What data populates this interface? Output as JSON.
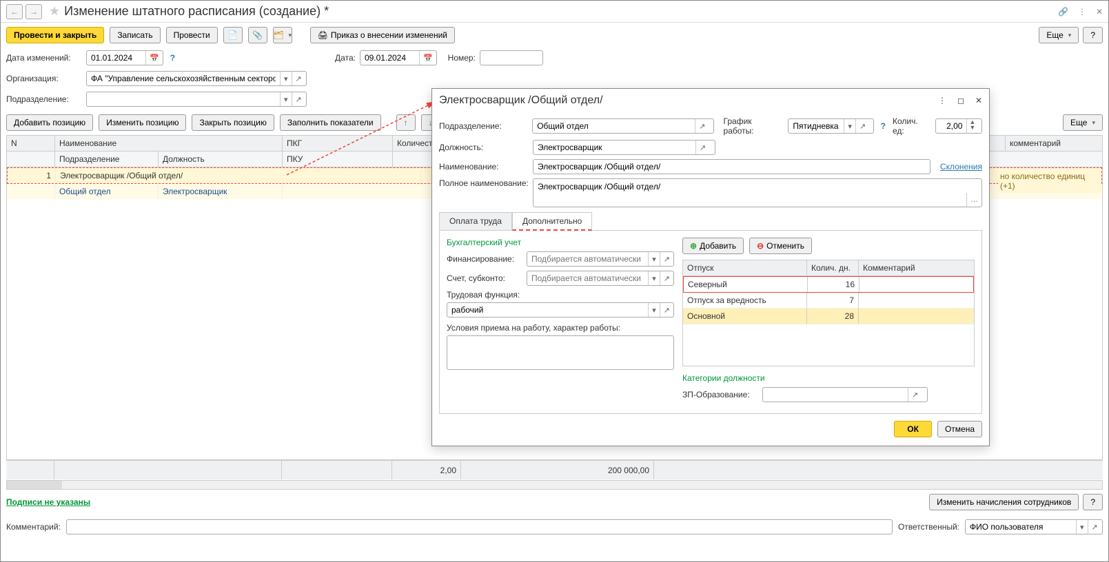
{
  "header": {
    "title": "Изменение штатного расписания (создание) *"
  },
  "toolbar": {
    "postAndClose": "Провести и закрыть",
    "save": "Записать",
    "post": "Провести",
    "orderBtn": "Приказ о внесении изменений",
    "more": "Еще",
    "help": "?",
    "moreRight": "Еще"
  },
  "form": {
    "dateChangesLabel": "Дата изменений:",
    "dateChanges": "01.01.2024",
    "dateLabel": "Дата:",
    "date": "09.01.2024",
    "numberLabel": "Номер:",
    "number": "",
    "orgLabel": "Организация:",
    "org": "ФА \"Управление сельскохозяйственным сектором\"",
    "subdivLabel": "Подразделение:",
    "subdiv": ""
  },
  "actions": {
    "addPos": "Добавить позицию",
    "editPos": "Изменить позицию",
    "closePos": "Закрыть позицию",
    "fillIndicators": "Заполнить показатели"
  },
  "grid": {
    "headers": {
      "n": "N",
      "name": "Наименование",
      "pkg": "ПКГ",
      "qty": "Количест"
    },
    "subheaders": {
      "subdiv": "Подразделение",
      "position": "Должность",
      "pku": "ПКУ"
    },
    "row": {
      "n": "1",
      "name": "Электросварщик /Общий отдел/",
      "subdiv": "Общий отдел",
      "position": "Электросварщик"
    },
    "rightNote1": "комментарий",
    "rightNote2": "но количество единиц (+1)"
  },
  "totals": {
    "qty": "2,00",
    "amount": "200 000,00"
  },
  "footer": {
    "signs": "Подписи не указаны",
    "changeAccruals": "Изменить начисления сотрудников",
    "commentLabel": "Комментарий:",
    "respLabel": "Ответственный:",
    "respValue": "ФИО пользователя"
  },
  "modal": {
    "title": "Электросварщик /Общий отдел/",
    "subdivLabel": "Подразделение:",
    "subdiv": "Общий отдел",
    "scheduleLabel": "График работы:",
    "schedule": "Пятидневка",
    "qtyLabel": "Колич. ед:",
    "qty": "2,00",
    "positionLabel": "Должность:",
    "position": "Электросварщик",
    "nameLabel": "Наименование:",
    "name": "Электросварщик /Общий отдел/",
    "declension": "Склонения",
    "fullNameLabel": "Полное наименование:",
    "fullName": "Электросварщик /Общий отдел/",
    "tabs": {
      "pay": "Оплата труда",
      "extra": "Дополнительно"
    },
    "accounting": {
      "title": "Бухгалтерский учет",
      "financeLabel": "Финансирование:",
      "financePlaceholder": "Подбирается автоматически",
      "accountLabel": "Счет, субконто:",
      "accountPlaceholder": "Подбирается автоматически"
    },
    "laborFuncLabel": "Трудовая функция:",
    "laborFunc": "рабочий",
    "conditionsLabel": "Условия приема на работу, характер работы:",
    "addBtn": "Добавить",
    "cancelBtn": "Отменить",
    "vacTable": {
      "h1": "Отпуск",
      "h2": "Колич. дн.",
      "h3": "Комментарий",
      "rows": [
        {
          "name": "Северный",
          "days": "16"
        },
        {
          "name": "Отпуск за вредность",
          "days": "7"
        },
        {
          "name": "Основной",
          "days": "28"
        }
      ]
    },
    "posCategoriesTitle": "Категории должности",
    "zpEduLabel": "ЗП-Образование:",
    "ok": "ОК",
    "cancel": "Отмена"
  }
}
